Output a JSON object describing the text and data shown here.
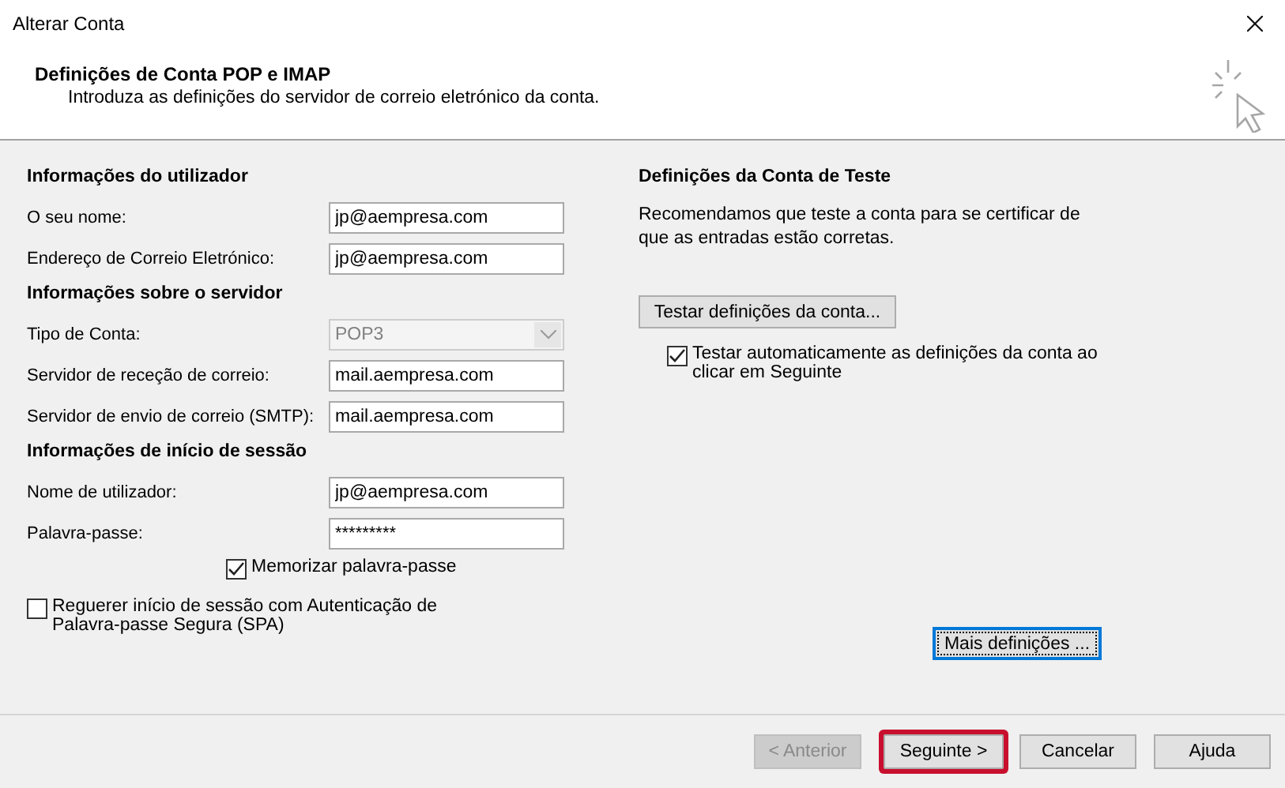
{
  "window": {
    "title": "Alterar Conta"
  },
  "header": {
    "title": "Definições de Conta POP e IMAP",
    "subtitle": "Introduza as definições do servidor de correio eletrónico da conta."
  },
  "sections": [
    {
      "heading": "Informações do utilizador",
      "fields": [
        {
          "kind": "text",
          "label": "O seu nome:",
          "value": "jp@aempresa.com"
        },
        {
          "kind": "text",
          "label": "Endereço de Correio Eletrónico:",
          "value": "jp@aempresa.com"
        }
      ]
    },
    {
      "heading": "Informações sobre o servidor",
      "fields": [
        {
          "kind": "select",
          "label": "Tipo de Conta:",
          "value": "POP3",
          "disabled": true
        },
        {
          "kind": "text",
          "label": "Servidor de receção de correio:",
          "value": "mail.aempresa.com"
        },
        {
          "kind": "text",
          "label": "Servidor de envio de correio (SMTP):",
          "value": "mail.aempresa.com"
        }
      ]
    },
    {
      "heading": "Informações de início de sessão",
      "fields": [
        {
          "kind": "text",
          "label": "Nome de utilizador:",
          "value": "jp@aempresa.com"
        },
        {
          "kind": "password",
          "label": "Palavra-passe:",
          "value": "*********"
        }
      ]
    }
  ],
  "remember_password": {
    "label": "Memorizar palavra-passe",
    "checked": true
  },
  "require_spa": {
    "label": "Reguerer início de sessão com Autenticação de Palavra-passe Segura (SPA)",
    "checked": false
  },
  "test": {
    "heading": "Definições da Conta de Teste",
    "description": "Recomendamos que teste a conta para se certificar de que as entradas estão corretas.",
    "button": "Testar definições da conta...",
    "auto_test": {
      "label": "Testar automaticamente as definições da conta ao clicar em Seguinte",
      "checked": true
    }
  },
  "more_settings": {
    "label": "Mais definições ...",
    "focused": true
  },
  "buttons": [
    {
      "label": "< Anterior",
      "disabled": true,
      "highlighted": false
    },
    {
      "label": "Seguinte >",
      "disabled": false,
      "highlighted": true
    },
    {
      "label": "Cancelar",
      "disabled": false,
      "highlighted": false
    },
    {
      "label": "Ajuda",
      "disabled": false,
      "highlighted": false
    }
  ]
}
